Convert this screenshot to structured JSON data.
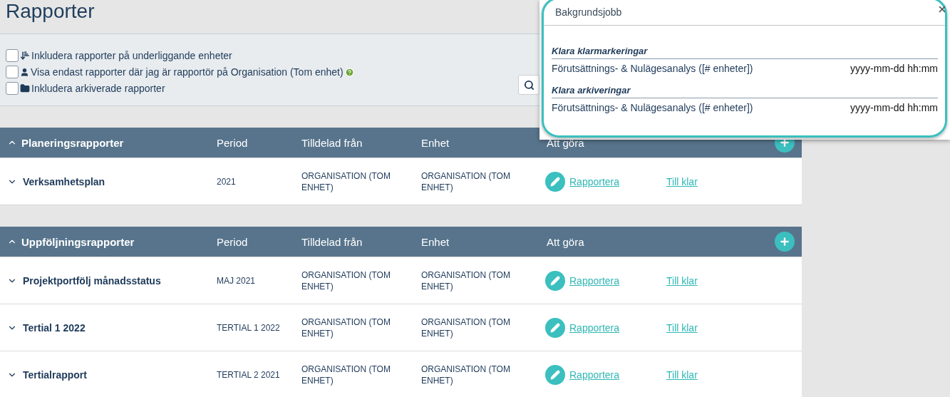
{
  "page_title": "Rapporter",
  "filters": [
    {
      "label": "Inkludera rapporter på underliggande enheter",
      "checked": false,
      "kind": "levels",
      "help": false
    },
    {
      "label": "Visa endast rapporter där jag är rapportör på Organisation (Tom enhet)",
      "checked": false,
      "kind": "user",
      "help": true
    },
    {
      "label": "Inkludera arkiverade rapporter",
      "checked": false,
      "kind": "folder",
      "help": false
    }
  ],
  "sections": [
    {
      "title": "Planeringsrapporter",
      "expanded": true,
      "columns": [
        "Period",
        "Tilldelad från",
        "Enhet",
        "Att göra"
      ],
      "rows": [
        {
          "name": "Verksamhetsplan",
          "expanded": false,
          "period": "2021",
          "assigned_from": "ORGANISATION (TOM ENHET)",
          "unit": "ORGANISATION (TOM ENHET)",
          "action": "Rapportera",
          "done_link": "Till klar"
        }
      ]
    },
    {
      "title": "Uppföljningsrapporter",
      "expanded": true,
      "columns": [
        "Period",
        "Tilldelad från",
        "Enhet",
        "Att göra"
      ],
      "rows": [
        {
          "name": "Projektportfölj månadsstatus",
          "expanded": false,
          "period": "MAJ 2021",
          "assigned_from": "ORGANISATION (TOM ENHET)",
          "unit": "ORGANISATION (TOM ENHET)",
          "action": "Rapportera",
          "done_link": "Till klar"
        },
        {
          "name": "Tertial 1 2022",
          "expanded": false,
          "period": "TERTIAL 1 2022",
          "assigned_from": "ORGANISATION (TOM ENHET)",
          "unit": "ORGANISATION (TOM ENHET)",
          "action": "Rapportera",
          "done_link": "Till klar"
        },
        {
          "name": "Tertialrapport",
          "expanded": false,
          "period": "TERTIAL 2 2021",
          "assigned_from": "ORGANISATION (TOM ENHET)",
          "unit": "ORGANISATION (TOM ENHET)",
          "action": "Rapportera",
          "done_link": "Till klar"
        }
      ]
    }
  ],
  "popup": {
    "title": "Bakgrundsjobb",
    "groups": [
      {
        "heading": "Klara klarmarkeringar",
        "items": [
          {
            "name": "Förutsättnings- & Nulägesanalys ([# enheter])",
            "time": "yyyy-mm-dd hh:mm"
          }
        ]
      },
      {
        "heading": "Klara arkiveringar",
        "items": [
          {
            "name": "Förutsättnings- & Nulägesanalys ([# enheter])",
            "time": "yyyy-mm-dd hh:mm"
          }
        ]
      }
    ]
  }
}
